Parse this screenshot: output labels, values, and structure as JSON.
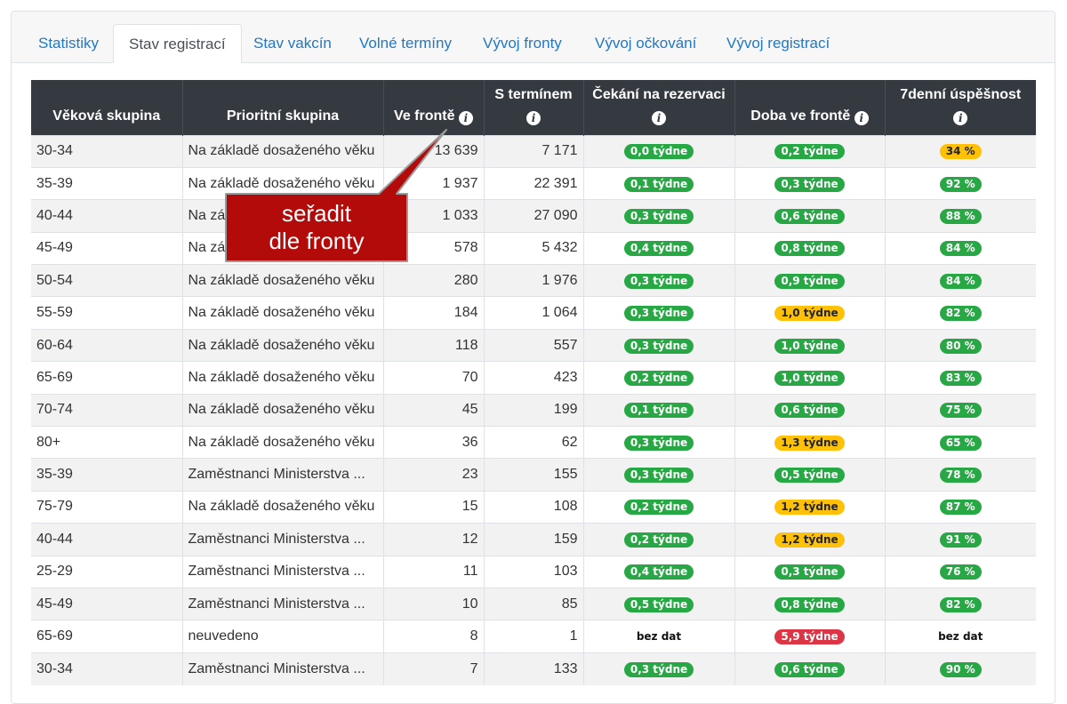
{
  "tabs": [
    "Statistiky",
    "Stav registrací",
    "Stav vakcín",
    "Volné termíny",
    "Vývoj fronty",
    "Vývoj očkování",
    "Vývoj registrací"
  ],
  "active_tab": 1,
  "columns": {
    "age": "Věková skupina",
    "priority": "Prioritní skupina",
    "queue": "Ve frontě",
    "booked": "S termínem",
    "wait": "Čekání na rezervaci",
    "duration": "Doba ve frontě",
    "success": "7denní úspěšnost"
  },
  "rows": [
    {
      "age": "30-34",
      "priority": "Na základě dosaženého věku",
      "queue": "13 639",
      "booked": "7 171",
      "wait": {
        "text": "0,0 týdne",
        "level": "green"
      },
      "duration": {
        "text": "0,2 týdne",
        "level": "green"
      },
      "success": {
        "text": "34 %",
        "level": "yellow"
      }
    },
    {
      "age": "35-39",
      "priority": "Na základě dosaženého věku",
      "queue": "1 937",
      "booked": "22 391",
      "wait": {
        "text": "0,1 týdne",
        "level": "green"
      },
      "duration": {
        "text": "0,3 týdne",
        "level": "green"
      },
      "success": {
        "text": "92 %",
        "level": "green"
      }
    },
    {
      "age": "40-44",
      "priority": "Na základě dosaženého věku",
      "queue": "1 033",
      "booked": "27 090",
      "wait": {
        "text": "0,3 týdne",
        "level": "green"
      },
      "duration": {
        "text": "0,6 týdne",
        "level": "green"
      },
      "success": {
        "text": "88 %",
        "level": "green"
      }
    },
    {
      "age": "45-49",
      "priority": "Na základě dosaženého věku",
      "queue": "578",
      "booked": "5 432",
      "wait": {
        "text": "0,4 týdne",
        "level": "green"
      },
      "duration": {
        "text": "0,8 týdne",
        "level": "green"
      },
      "success": {
        "text": "84 %",
        "level": "green"
      }
    },
    {
      "age": "50-54",
      "priority": "Na základě dosaženého věku",
      "queue": "280",
      "booked": "1 976",
      "wait": {
        "text": "0,3 týdne",
        "level": "green"
      },
      "duration": {
        "text": "0,9 týdne",
        "level": "green"
      },
      "success": {
        "text": "84 %",
        "level": "green"
      }
    },
    {
      "age": "55-59",
      "priority": "Na základě dosaženého věku",
      "queue": "184",
      "booked": "1 064",
      "wait": {
        "text": "0,3 týdne",
        "level": "green"
      },
      "duration": {
        "text": "1,0 týdne",
        "level": "yellow"
      },
      "success": {
        "text": "82 %",
        "level": "green"
      }
    },
    {
      "age": "60-64",
      "priority": "Na základě dosaženého věku",
      "queue": "118",
      "booked": "557",
      "wait": {
        "text": "0,3 týdne",
        "level": "green"
      },
      "duration": {
        "text": "1,0 týdne",
        "level": "green"
      },
      "success": {
        "text": "80 %",
        "level": "green"
      }
    },
    {
      "age": "65-69",
      "priority": "Na základě dosaženého věku",
      "queue": "70",
      "booked": "423",
      "wait": {
        "text": "0,2 týdne",
        "level": "green"
      },
      "duration": {
        "text": "1,0 týdne",
        "level": "green"
      },
      "success": {
        "text": "83 %",
        "level": "green"
      }
    },
    {
      "age": "70-74",
      "priority": "Na základě dosaženého věku",
      "queue": "45",
      "booked": "199",
      "wait": {
        "text": "0,1 týdne",
        "level": "green"
      },
      "duration": {
        "text": "0,6 týdne",
        "level": "green"
      },
      "success": {
        "text": "75 %",
        "level": "green"
      }
    },
    {
      "age": "80+",
      "priority": "Na základě dosaženého věku",
      "queue": "36",
      "booked": "62",
      "wait": {
        "text": "0,3 týdne",
        "level": "green"
      },
      "duration": {
        "text": "1,3 týdne",
        "level": "yellow"
      },
      "success": {
        "text": "65 %",
        "level": "green"
      }
    },
    {
      "age": "35-39",
      "priority": "Zaměstnanci Ministerstva ...",
      "queue": "23",
      "booked": "155",
      "wait": {
        "text": "0,3 týdne",
        "level": "green"
      },
      "duration": {
        "text": "0,5 týdne",
        "level": "green"
      },
      "success": {
        "text": "78 %",
        "level": "green"
      }
    },
    {
      "age": "75-79",
      "priority": "Na základě dosaženého věku",
      "queue": "15",
      "booked": "108",
      "wait": {
        "text": "0,2 týdne",
        "level": "green"
      },
      "duration": {
        "text": "1,2 týdne",
        "level": "yellow"
      },
      "success": {
        "text": "87 %",
        "level": "green"
      }
    },
    {
      "age": "40-44",
      "priority": "Zaměstnanci Ministerstva ...",
      "queue": "12",
      "booked": "159",
      "wait": {
        "text": "0,2 týdne",
        "level": "green"
      },
      "duration": {
        "text": "1,2 týdne",
        "level": "yellow"
      },
      "success": {
        "text": "91 %",
        "level": "green"
      }
    },
    {
      "age": "25-29",
      "priority": "Zaměstnanci Ministerstva ...",
      "queue": "11",
      "booked": "103",
      "wait": {
        "text": "0,4 týdne",
        "level": "green"
      },
      "duration": {
        "text": "0,3 týdne",
        "level": "green"
      },
      "success": {
        "text": "76 %",
        "level": "green"
      }
    },
    {
      "age": "45-49",
      "priority": "Zaměstnanci Ministerstva ...",
      "queue": "10",
      "booked": "85",
      "wait": {
        "text": "0,5 týdne",
        "level": "green"
      },
      "duration": {
        "text": "0,8 týdne",
        "level": "green"
      },
      "success": {
        "text": "82 %",
        "level": "green"
      }
    },
    {
      "age": "65-69",
      "priority": "neuvedeno",
      "queue": "8",
      "booked": "1",
      "wait": {
        "text": "bez dat",
        "level": "none"
      },
      "duration": {
        "text": "5,9 týdne",
        "level": "red"
      },
      "success": {
        "text": "bez dat",
        "level": "none"
      }
    },
    {
      "age": "30-34",
      "priority": "Zaměstnanci Ministerstva ...",
      "queue": "7",
      "booked": "133",
      "wait": {
        "text": "0,3 týdne",
        "level": "green"
      },
      "duration": {
        "text": "0,6 týdne",
        "level": "green"
      },
      "success": {
        "text": "90 %",
        "level": "green"
      }
    }
  ],
  "callout": {
    "line1": "seřadit",
    "line2": "dle fronty"
  },
  "colors": {
    "callout_fill": "#b30a0a",
    "header_bg": "#343a40",
    "link": "#1f78c8",
    "green": "#28a745",
    "yellow": "#ffc107",
    "red": "#dc3545"
  }
}
